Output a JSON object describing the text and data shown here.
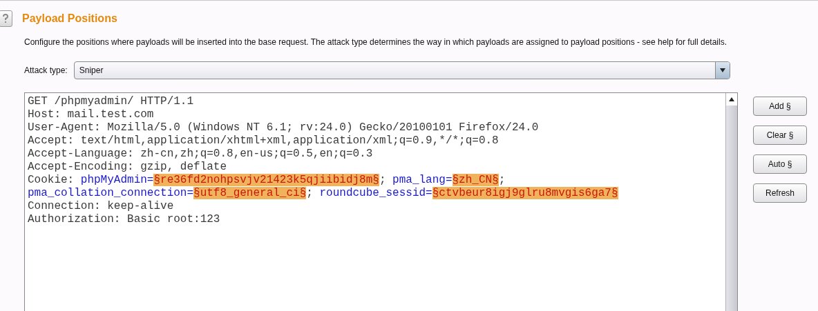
{
  "section": {
    "title": "Payload Positions",
    "description": "Configure the positions where payloads will be inserted into the base request. The attack type determines the way in which payloads are assigned to payload positions - see help for full details."
  },
  "attack_type": {
    "label": "Attack type:",
    "value": "Sniper"
  },
  "request_lines": [
    [
      {
        "kind": "plain",
        "text": "GET /phpmyadmin/ HTTP/1.1"
      }
    ],
    [
      {
        "kind": "plain",
        "text": "Host: mail.test.com"
      }
    ],
    [
      {
        "kind": "plain",
        "text": "User-Agent: Mozilla/5.0 (Windows NT 6.1; rv:24.0) Gecko/20100101 Firefox/24.0"
      }
    ],
    [
      {
        "kind": "plain",
        "text": "Accept: text/html,application/xhtml+xml,application/xml;q=0.9,*/*;q=0.8"
      }
    ],
    [
      {
        "kind": "plain",
        "text": "Accept-Language: zh-cn,zh;q=0.8,en-us;q=0.5,en;q=0.3"
      }
    ],
    [
      {
        "kind": "plain",
        "text": "Accept-Encoding: gzip, deflate"
      }
    ],
    [
      {
        "kind": "plain",
        "text": "Cookie: "
      },
      {
        "kind": "name",
        "text": "phpMyAdmin="
      },
      {
        "kind": "payload",
        "text": "§re36fd2nohpsvjv21423k5qjiibidj8m§"
      },
      {
        "kind": "plain",
        "text": "; "
      },
      {
        "kind": "name",
        "text": "pma_lang="
      },
      {
        "kind": "payload",
        "text": "§zh_CN§"
      },
      {
        "kind": "plain",
        "text": ";"
      }
    ],
    [
      {
        "kind": "name",
        "text": "pma_collation_connection="
      },
      {
        "kind": "payload",
        "text": "§utf8_general_ci§"
      },
      {
        "kind": "plain",
        "text": "; "
      },
      {
        "kind": "name",
        "text": "roundcube_sessid="
      },
      {
        "kind": "payload",
        "text": "§ctvbeur8igj9glru8mvgis6ga7§"
      }
    ],
    [
      {
        "kind": "plain",
        "text": "Connection: keep-alive"
      }
    ],
    [
      {
        "kind": "plain",
        "text": "Authorization: Basic root:123"
      }
    ]
  ],
  "buttons": [
    "Add §",
    "Clear §",
    "Auto §",
    "Refresh"
  ]
}
